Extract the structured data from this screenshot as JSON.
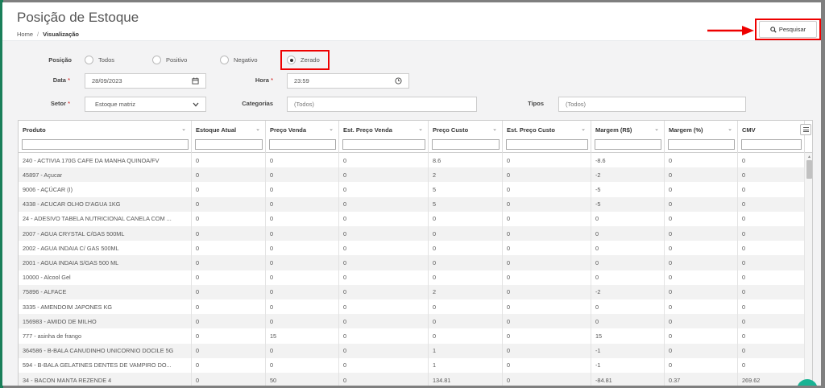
{
  "header": {
    "title": "Posição de Estoque",
    "breadcrumb": {
      "home": "Home",
      "separator": "/",
      "current": "Visualização"
    },
    "search_button": {
      "label": "Pesquisar",
      "icon": "search-icon"
    }
  },
  "form": {
    "posicao": {
      "label": "Posição",
      "options": [
        "Todos",
        "Positivo",
        "Negativo",
        "Zerado"
      ],
      "selected": "Zerado"
    },
    "data": {
      "label": "Data",
      "required_mark": "*",
      "value": "28/09/2023",
      "icon": "calendar-icon"
    },
    "hora": {
      "label": "Hora",
      "required_mark": "*",
      "value": "23:59",
      "icon": "clock-icon"
    },
    "setor": {
      "label": "Setor",
      "required_mark": "*",
      "value": "Estoque matriz",
      "icon": "chevron-down-icon"
    },
    "categorias": {
      "label": "Categorias",
      "placeholder": "(Todos)"
    },
    "tipos": {
      "label": "Tipos",
      "placeholder": "(Todos)"
    }
  },
  "table": {
    "columns": [
      "Produto",
      "Estoque Atual",
      "Preço Venda",
      "Est. Preço Venda",
      "Preço Custo",
      "Est. Preço Custo",
      "Margem (R$)",
      "Margem (%)",
      "CMV"
    ],
    "rows": [
      [
        "240 - ACTIVIA 170G CAFE DA MANHA QUINOA/FV",
        "0",
        "0",
        "0",
        "8.6",
        "0",
        "-8.6",
        "0",
        "0"
      ],
      [
        "45897 - Açucar",
        "0",
        "0",
        "0",
        "2",
        "0",
        "-2",
        "0",
        "0"
      ],
      [
        "9006 - AÇÚCAR (I)",
        "0",
        "0",
        "0",
        "5",
        "0",
        "-5",
        "0",
        "0"
      ],
      [
        "4338 - ACUCAR OLHO D'AGUA 1KG",
        "0",
        "0",
        "0",
        "5",
        "0",
        "-5",
        "0",
        "0"
      ],
      [
        "24 - ADESIVO TABELA NUTRICIONAL CANELA COM ...",
        "0",
        "0",
        "0",
        "0",
        "0",
        "0",
        "0",
        "0"
      ],
      [
        "2007 - AGUA CRYSTAL C/GAS 500ML",
        "0",
        "0",
        "0",
        "0",
        "0",
        "0",
        "0",
        "0"
      ],
      [
        "2002 - AGUA INDAIA C/ GAS 500ML",
        "0",
        "0",
        "0",
        "0",
        "0",
        "0",
        "0",
        "0"
      ],
      [
        "2001 - AGUA INDAIA S/GAS 500 ML",
        "0",
        "0",
        "0",
        "0",
        "0",
        "0",
        "0",
        "0"
      ],
      [
        "10000 - Alcool Gel",
        "0",
        "0",
        "0",
        "0",
        "0",
        "0",
        "0",
        "0"
      ],
      [
        "75896 - ALFACE",
        "0",
        "0",
        "0",
        "2",
        "0",
        "-2",
        "0",
        "0"
      ],
      [
        "3335 - AMENDOIM JAPONES KG",
        "0",
        "0",
        "0",
        "0",
        "0",
        "0",
        "0",
        "0"
      ],
      [
        "156983 - AMIDO DE MILHO",
        "0",
        "0",
        "0",
        "0",
        "0",
        "0",
        "0",
        "0"
      ],
      [
        "777 - asinha de frango",
        "0",
        "15",
        "0",
        "0",
        "0",
        "15",
        "0",
        "0"
      ],
      [
        "364586 - B-BALA CANUDINHO UNICORNIO DOCILE 5G",
        "0",
        "0",
        "0",
        "1",
        "0",
        "-1",
        "0",
        "0"
      ],
      [
        "594 - B-BALA GELATINES DENTES DE VAMPIRO DO...",
        "0",
        "0",
        "0",
        "1",
        "0",
        "-1",
        "0",
        "0"
      ],
      [
        "34 - BACON MANTA REZENDE 4",
        "0",
        "50",
        "0",
        "134.81",
        "0",
        "-84.81",
        "0.37",
        "269.62"
      ]
    ]
  },
  "colors": {
    "accent_green": "#1ab394",
    "annotation_red": "#e00000"
  }
}
